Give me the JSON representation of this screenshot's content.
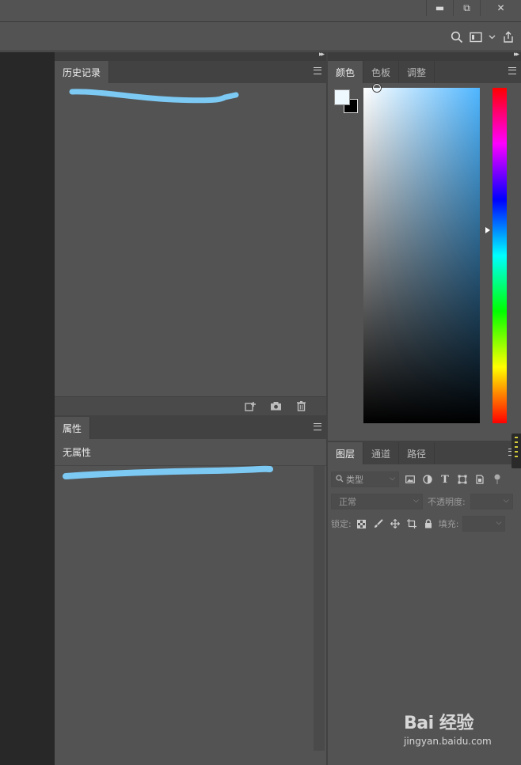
{
  "window": {
    "minimize": "▬",
    "restore": "⧉",
    "close": "✕"
  },
  "history_panel": {
    "tab_label": "历史记录"
  },
  "properties_panel": {
    "tab_label": "属性",
    "empty_text": "无属性"
  },
  "color_panel": {
    "tabs": [
      "颜色",
      "色板",
      "调整"
    ],
    "foreground": "#eef8ff",
    "background": "#000000",
    "hue_color": "#4fb6ff"
  },
  "layers_panel": {
    "tabs": [
      "图层",
      "通道",
      "路径"
    ],
    "filter_placeholder": "类型",
    "blend_mode": "正常",
    "opacity_label": "不透明度:",
    "lock_label": "锁定:",
    "fill_label": "填充:"
  },
  "watermark": {
    "logo_text": "Bai 经验",
    "url": "jingyan.baidu.com"
  }
}
